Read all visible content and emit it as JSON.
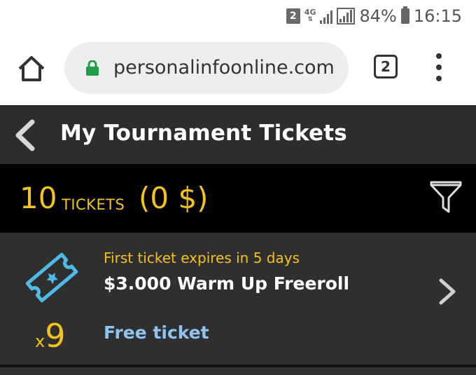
{
  "status_bar": {
    "sim_slot": "2",
    "network": "4G",
    "battery": "84%",
    "time": "16:15"
  },
  "browser": {
    "url": "personalinfoonline.com",
    "tab_count": "2",
    "icons": [
      "home-icon",
      "lock-icon",
      "tabs-icon",
      "more-vert-icon"
    ]
  },
  "header": {
    "title": "My Tournament Tickets",
    "back_icon": "chevron-left-icon"
  },
  "summary": {
    "count": "10",
    "label": "TICKETS",
    "amount": "(0 $)",
    "filter_icon": "filter-icon"
  },
  "tickets": [
    {
      "expiry": "First ticket expires in 5 days",
      "name": "$3.000 Warm Up Freeroll",
      "type": "Free ticket",
      "quantity_prefix": "x",
      "quantity": "9"
    }
  ],
  "colors": {
    "accent": "#f2c21d",
    "free_label": "#8fc4f0",
    "ticket_icon": "#4fb9e8"
  }
}
